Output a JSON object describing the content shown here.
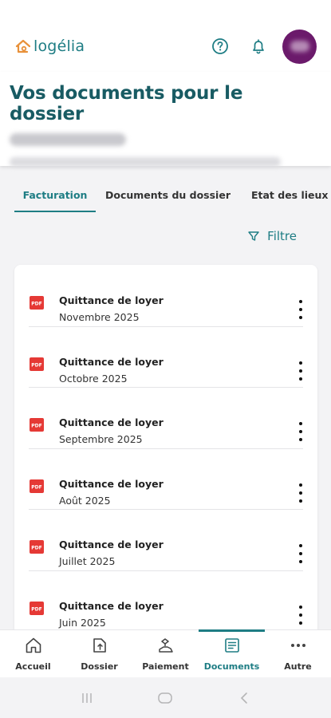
{
  "app": {
    "brand": "logélia",
    "accent_color": "#1e7d84",
    "title_color": "#185b63",
    "avatar_color": "#6b1a6b"
  },
  "header": {
    "icons": [
      "help-circle-icon",
      "bell-icon"
    ]
  },
  "hero": {
    "title": "Vos documents pour le dossier"
  },
  "tabs": [
    {
      "label": "Facturation",
      "active": true
    },
    {
      "label": "Documents du dossier",
      "active": false
    },
    {
      "label": "Etat des lieux",
      "active": false
    }
  ],
  "filter": {
    "label": "Filtre",
    "icon": "filter-icon"
  },
  "documents": [
    {
      "title": "Quittance de loyer",
      "date": "Novembre 2025"
    },
    {
      "title": "Quittance de loyer",
      "date": "Octobre 2025"
    },
    {
      "title": "Quittance de loyer",
      "date": "Septembre 2025"
    },
    {
      "title": "Quittance de loyer",
      "date": "Août 2025"
    },
    {
      "title": "Quittance de loyer",
      "date": "Juillet 2025"
    },
    {
      "title": "Quittance de loyer",
      "date": "Juin 2025"
    }
  ],
  "bottom_nav": [
    {
      "label": "Accueil",
      "icon": "home-icon",
      "active": false
    },
    {
      "label": "Dossier",
      "icon": "folder-icon",
      "active": false
    },
    {
      "label": "Paiement",
      "icon": "payment-icon",
      "active": false
    },
    {
      "label": "Documents",
      "icon": "documents-icon",
      "active": true
    },
    {
      "label": "Autre",
      "icon": "more-icon",
      "active": false
    }
  ]
}
